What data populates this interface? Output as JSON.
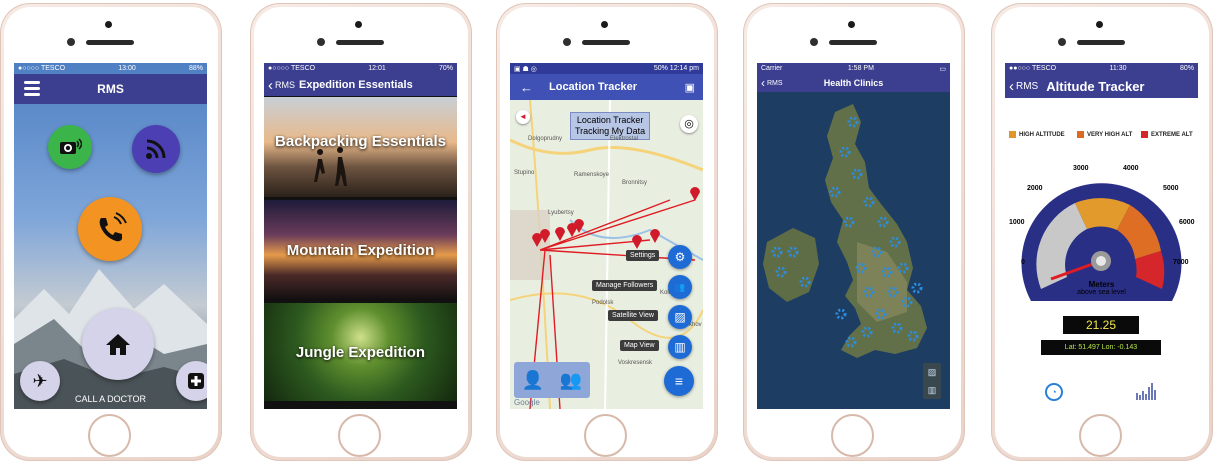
{
  "phone1": {
    "status": {
      "carrier": "●○○○○ TESCO",
      "time": "13:00",
      "battery": "88%"
    },
    "title": "RMS",
    "call_label": "CALL A DOCTOR"
  },
  "phone2": {
    "status": {
      "carrier": "●○○○○ TESCO",
      "time": "12:01",
      "battery": "70%"
    },
    "back_label": "RMS",
    "title": "Expedition Essentials",
    "tiles": [
      "Backpacking Essentials",
      "Mountain Expedition",
      "Jungle Expedition"
    ]
  },
  "phone3": {
    "status": {
      "right": "50%  12:14 pm"
    },
    "title": "Location Tracker",
    "tracking_title": "Location Tracker",
    "tracking_sub": "Tracking My Data",
    "menu": [
      "Settings",
      "Manage Followers",
      "Satellite View",
      "Map View"
    ],
    "map_labels": [
      "Dolgoprudny",
      "Elektrostal",
      "Stupino",
      "Podolsk",
      "Lyubertsy",
      "Ramenskoye",
      "Bronnitsy",
      "Chekhov",
      "Kolomna",
      "Voskresensk"
    ],
    "google": "Google"
  },
  "phone4": {
    "status": {
      "carrier": "Carrier",
      "time": "1:58 PM"
    },
    "back_label": "RMS",
    "title": "Health Clinics"
  },
  "phone5": {
    "status": {
      "carrier": "●●○○○ TESCO",
      "time": "11:30",
      "battery": "80%"
    },
    "back_label": "RMS",
    "title": "Altitude Tracker",
    "legend": [
      {
        "label": "HIGH ALTITUDE",
        "color": "#e0962a"
      },
      {
        "label": "VERY HIGH ALT",
        "color": "#dc6a22"
      },
      {
        "label": "EXTREME ALT",
        "color": "#d5262a"
      }
    ],
    "gauge_ticks": [
      "0",
      "1000",
      "2000",
      "3000",
      "4000",
      "5000",
      "6000",
      "7000"
    ],
    "gauge_unit": "Meters",
    "gauge_sub": "above sea level",
    "reading": "21.25",
    "coords": "Lat: 51.497  Lon: -0.143"
  },
  "colors": {
    "nav": "#3c3f8f",
    "fab": "#1e6bd6",
    "pin": "#d11a2a",
    "clinic": "#2a8de0"
  }
}
